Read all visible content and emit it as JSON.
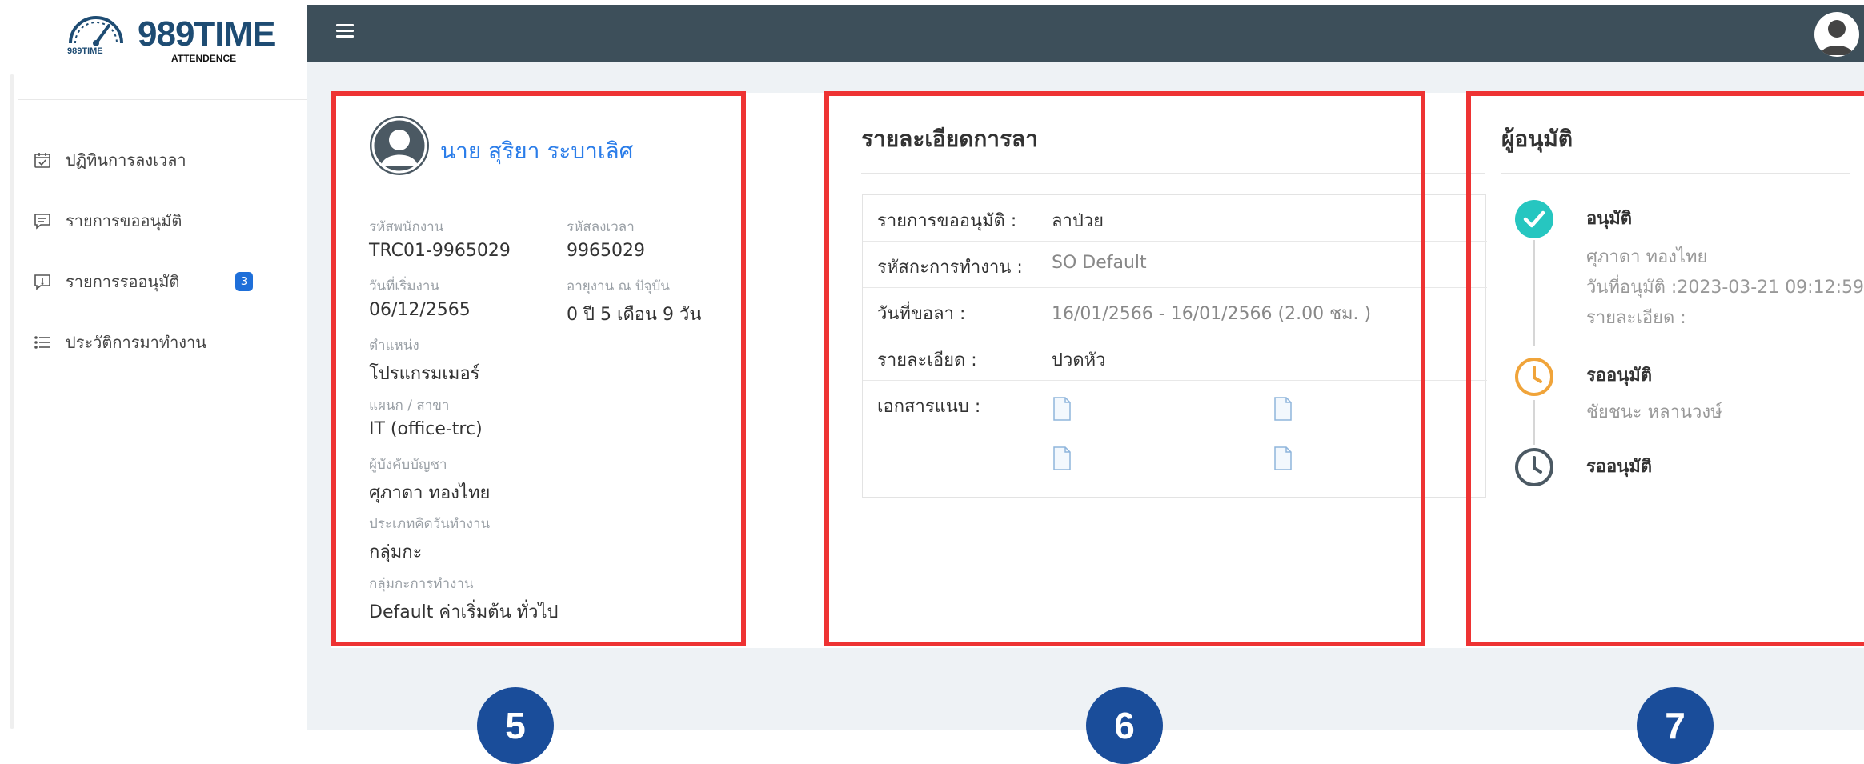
{
  "brand": {
    "name": "989TIME",
    "sub": "ATTENDENCE",
    "mini": "989TIME"
  },
  "sidebar": {
    "items": [
      {
        "label": "ปฏิทินการลงเวลา",
        "icon": "calendar-check-icon"
      },
      {
        "label": "รายการขออนุมัติ",
        "icon": "message-list-icon"
      },
      {
        "label": "รายการรออนุมัติ",
        "icon": "message-alert-icon",
        "badge": "3"
      },
      {
        "label": "ประวัติการมาทำงาน",
        "icon": "list-icon"
      }
    ]
  },
  "employee": {
    "name": "นาย สุริยา ระบาเลิศ",
    "fields": [
      {
        "label": "รหัสพนักงาน",
        "value": "TRC01-9965029"
      },
      {
        "label": "รหัสลงเวลา",
        "value": "9965029"
      },
      {
        "label": "วันที่เริ่มงาน",
        "value": "06/12/2565"
      },
      {
        "label": "อายุงาน ณ ปัจุบัน",
        "value": "0 ปี 5 เดือน 9 วัน"
      },
      {
        "label": "ตำแหน่ง",
        "value": "โปรแกรมเมอร์"
      },
      {
        "label": "แผนก / สาขา",
        "value": "IT (office-trc)"
      },
      {
        "label": "ผู้บังคับบัญชา",
        "value": "ศุภาดา ทองไทย"
      },
      {
        "label": "ประเภทคิดวันทำงาน",
        "value": "กลุ่มกะ"
      },
      {
        "label": "กลุ่มกะการทำงาน",
        "value": "Default ค่าเริ่มต้น ทั่วไป"
      }
    ]
  },
  "detail": {
    "title": "รายละเอียดการลา",
    "rows": [
      {
        "key": "รายการขออนุมัติ :",
        "value": "ลาป่วย"
      },
      {
        "key": "รหัสกะการทำงาน :",
        "value": "SO Default"
      },
      {
        "key": "วันที่ขอลา :",
        "value": "16/01/2566 - 16/01/2566 (2.00 ชม. )"
      },
      {
        "key": "รายละเอียด :",
        "value": "ปวดหัว"
      },
      {
        "key": "เอกสารแนบ :",
        "value": ""
      }
    ]
  },
  "approver": {
    "title": "ผู้อนุมัติ",
    "steps": [
      {
        "status": "อนุมัติ",
        "lines": [
          "ศุภาดา ทองไทย",
          "วันที่อนุมัติ :2023-03-21 09:12:59",
          "รายละเอียด :"
        ],
        "color": "#26c6c0",
        "icon": "check-circle-icon"
      },
      {
        "status": "รออนุมัติ",
        "lines": [
          "ชัยชนะ หลานวงษ์"
        ],
        "color": "#f0a43a",
        "icon": "clock-icon"
      },
      {
        "status": "รออนุมัติ",
        "lines": [],
        "color": "#4b5963",
        "icon": "clock-icon"
      }
    ]
  },
  "steps_labels": [
    "5",
    "6",
    "7"
  ],
  "colors": {
    "topbar": "#3d4f5a",
    "accent": "#2b7de9",
    "highlight": "#ee3333",
    "step_badge": "#1a4d9a"
  }
}
